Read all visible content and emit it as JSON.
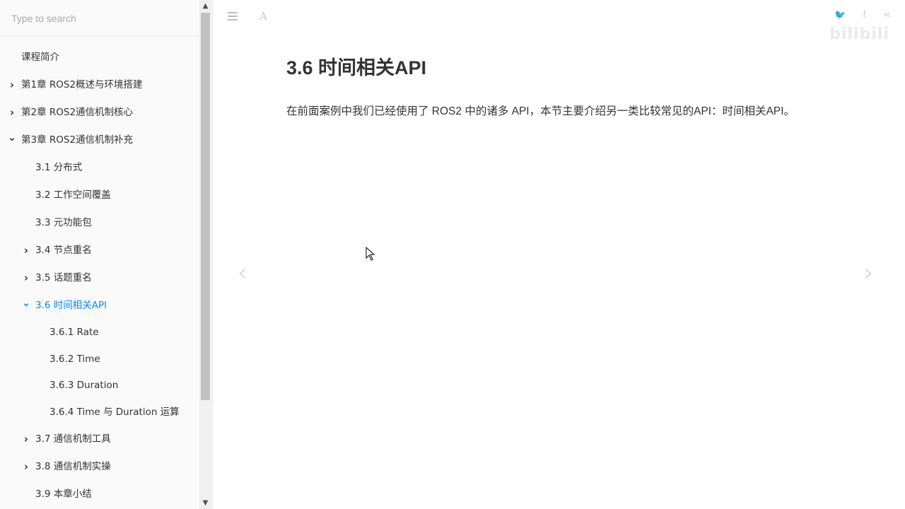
{
  "search": {
    "placeholder": "Type to search"
  },
  "toc": [
    {
      "label": "课程简介",
      "chevron": ""
    },
    {
      "label": "第1章 ROS2概述与环境搭建",
      "chevron": "›"
    },
    {
      "label": "第2章 ROS2通信机制核心",
      "chevron": "›"
    },
    {
      "label": "第3章 ROS2通信机制补充",
      "chevron": "⌄"
    },
    {
      "label": "3.1 分布式",
      "chevron": ""
    },
    {
      "label": "3.2 工作空间覆盖",
      "chevron": ""
    },
    {
      "label": "3.3 元功能包",
      "chevron": ""
    },
    {
      "label": "3.4 节点重名",
      "chevron": "›"
    },
    {
      "label": "3.5 话题重名",
      "chevron": "›"
    },
    {
      "label": "3.6 时间相关API",
      "chevron": "⌄"
    },
    {
      "label": "3.6.1 Rate",
      "chevron": ""
    },
    {
      "label": "3.6.2 Time",
      "chevron": ""
    },
    {
      "label": "3.6.3 Duration",
      "chevron": ""
    },
    {
      "label": "3.6.4 Time 与 Duration 运算",
      "chevron": ""
    },
    {
      "label": "3.7 通信机制工具",
      "chevron": "›"
    },
    {
      "label": "3.8 通信机制实操",
      "chevron": "›"
    },
    {
      "label": "3.9 本章小结",
      "chevron": ""
    }
  ],
  "header": {
    "font_label": "A",
    "share": [
      "🐦",
      "f",
      "⋖"
    ],
    "watermark": "bilibili"
  },
  "content": {
    "title": "3.6 时间相关API",
    "intro": "在前面案例中我们已经使用了 ROS2 中的诸多 API，本节主要介绍另一类比较常见的API：时间相关API。"
  },
  "nav": {
    "prev": "‹",
    "next": "›"
  },
  "colors": {
    "active": "#008cff",
    "text": "#333333",
    "sidebar_bg": "#fafafa"
  }
}
